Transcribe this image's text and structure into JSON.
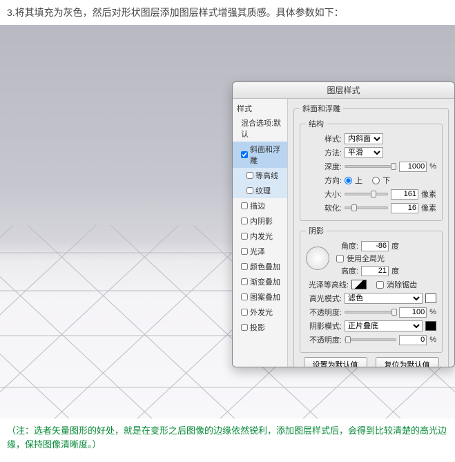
{
  "top_text": "3.将其填充为灰色，然后对形状图层添加图层样式增强其质感。具体参数如下：",
  "bottom_text": "（注：选者矢量图形的好处，就是在变形之后图像的边缘依然锐利，添加图层样式后，会得到比较清楚的高光边缘，保持图像清晰度。）",
  "dialog": {
    "title": "图层样式",
    "sidebar_header": "样式",
    "items": [
      {
        "label": "混合选项:默认",
        "checked": null
      },
      {
        "label": "斜面和浮雕",
        "checked": true,
        "selected": true
      },
      {
        "label": "等高线",
        "checked": false,
        "sub": true
      },
      {
        "label": "纹理",
        "checked": false,
        "sub": true
      },
      {
        "label": "描边",
        "checked": false
      },
      {
        "label": "内阴影",
        "checked": false
      },
      {
        "label": "内发光",
        "checked": false
      },
      {
        "label": "光泽",
        "checked": false
      },
      {
        "label": "颜色叠加",
        "checked": false
      },
      {
        "label": "渐变叠加",
        "checked": false
      },
      {
        "label": "图案叠加",
        "checked": false
      },
      {
        "label": "外发光",
        "checked": false
      },
      {
        "label": "投影",
        "checked": false
      }
    ],
    "group_outer": "斜面和浮雕",
    "group_struct": "结构",
    "style_label": "样式:",
    "style_value": "内斜面",
    "method_label": "方法:",
    "method_value": "平滑",
    "depth_label": "深度:",
    "depth_value": "1000",
    "depth_unit": "%",
    "dir_label": "方向:",
    "dir_up": "上",
    "dir_down": "下",
    "size_label": "大小:",
    "size_value": "161",
    "size_unit": "像素",
    "soften_label": "软化:",
    "soften_value": "16",
    "soften_unit": "像素",
    "group_shade": "阴影",
    "angle_label": "角度:",
    "angle_value": "-86",
    "angle_unit": "度",
    "global_light": "使用全局光",
    "alt_label": "高度:",
    "alt_value": "21",
    "alt_unit": "度",
    "gloss_label": "光泽等高线:",
    "anti_alias": "消除锯齿",
    "hl_mode_label": "高光模式:",
    "hl_mode_value": "滤色",
    "hl_opacity_label": "不透明度:",
    "hl_opacity_value": "100",
    "hl_opacity_unit": "%",
    "sh_mode_label": "阴影模式:",
    "sh_mode_value": "正片叠底",
    "sh_opacity_label": "不透明度:",
    "sh_opacity_value": "0",
    "sh_opacity_unit": "%",
    "btn_default": "设置为默认值",
    "btn_reset": "复位为默认值",
    "colors": {
      "hl_swatch": "#ffffff",
      "sh_swatch": "#000000"
    }
  }
}
